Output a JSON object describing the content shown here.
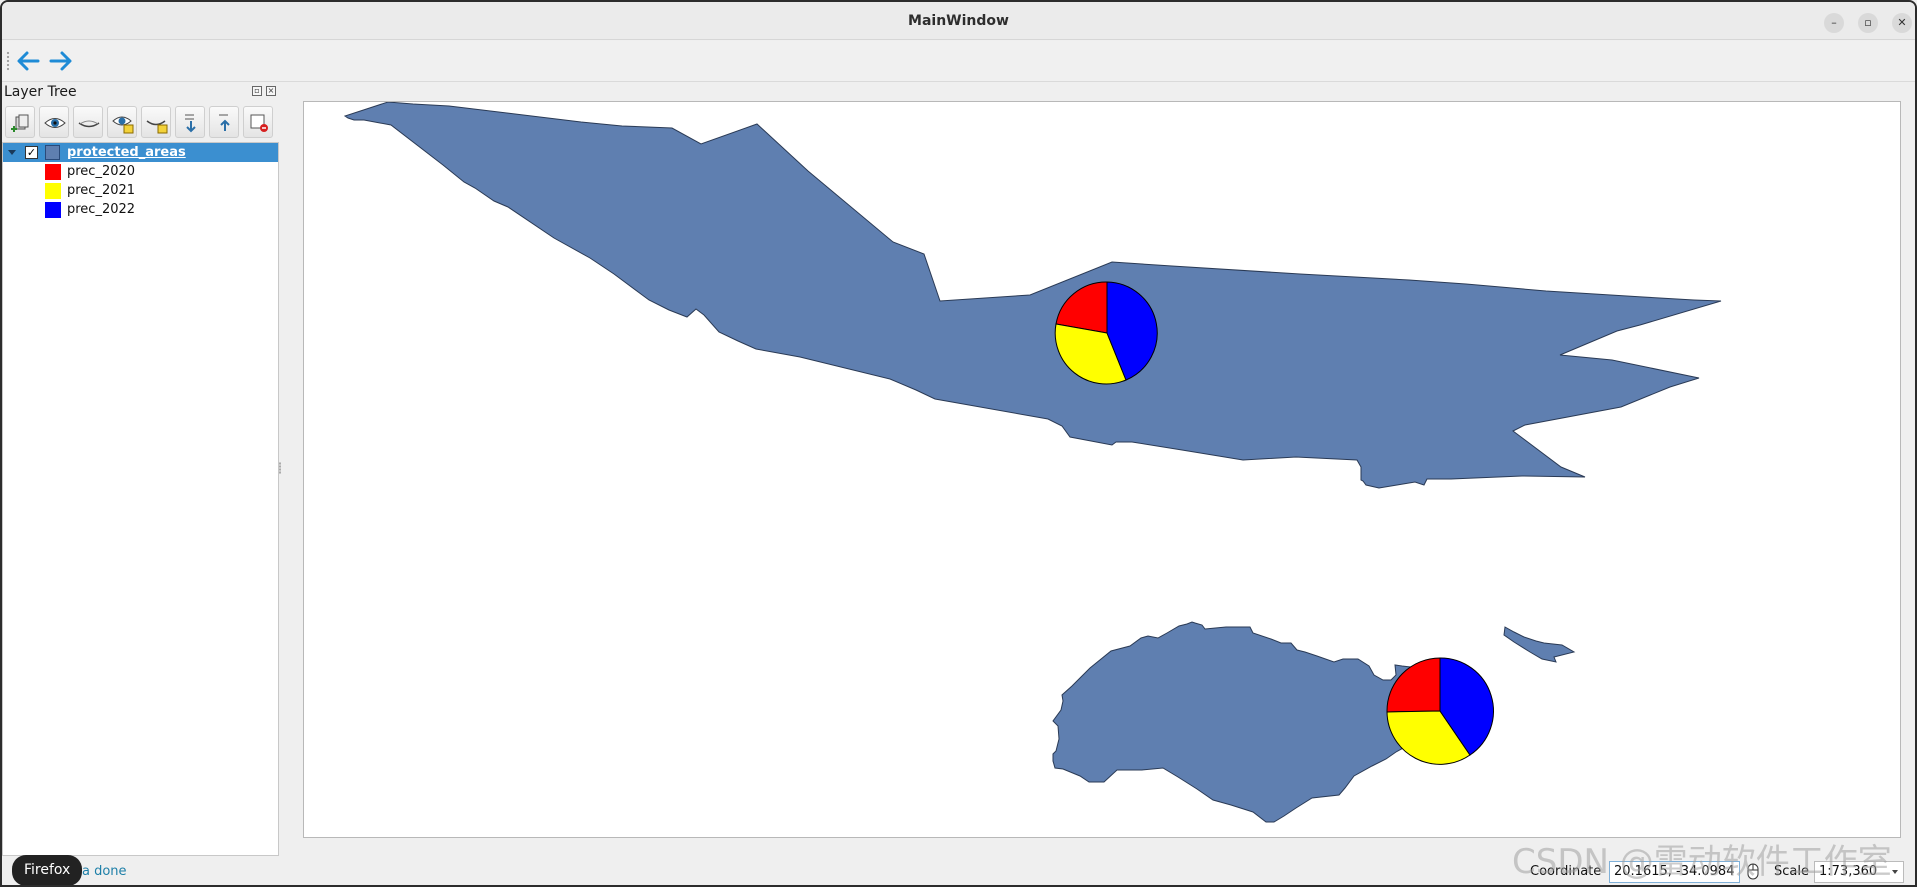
{
  "window": {
    "title": "MainWindow",
    "controls": [
      {
        "name": "minimize",
        "icon": "minimize-icon",
        "glyph": "–"
      },
      {
        "name": "maximize",
        "icon": "maximize-icon",
        "glyph": "▫"
      },
      {
        "name": "close",
        "icon": "close-icon",
        "glyph": "✕"
      }
    ]
  },
  "toolbar": {
    "back": {
      "icon": "arrow-left-icon"
    },
    "forward": {
      "icon": "arrow-right-icon"
    },
    "accent": "#1e8bd6"
  },
  "layer_tree": {
    "title": "Layer Tree",
    "tools": [
      {
        "icon": "add-group-icon"
      },
      {
        "icon": "show-all-layers-icon"
      },
      {
        "icon": "hide-all-layers-icon"
      },
      {
        "icon": "show-selected-layers-icon"
      },
      {
        "icon": "hide-selected-layers-icon"
      },
      {
        "icon": "expand-all-icon"
      },
      {
        "icon": "collapse-all-icon"
      },
      {
        "icon": "remove-layer-icon"
      }
    ],
    "layer": {
      "name": "protected_areas",
      "checked": true,
      "selected": true,
      "check_glyph": "✓",
      "fill_color": "#5f7fb0"
    },
    "legend": [
      {
        "label": "prec_2020",
        "color": "#ff0000"
      },
      {
        "label": "prec_2021",
        "color": "#ffff00"
      },
      {
        "label": "prec_2022",
        "color": "#0000ff"
      }
    ]
  },
  "map": {
    "background": "#ffffff",
    "polygon_fill": "#5f7fb0",
    "polygon_stroke": "#2a3a55",
    "pie_colors": [
      "#ff0000",
      "#ffff00",
      "#0000ff"
    ]
  },
  "status": {
    "message": "a done",
    "tooltip": "Firefox",
    "coordinate_label": "Coordinate",
    "coordinate_value": "20.1615, -34.0984",
    "scale_label": "Scale",
    "scale_value": "1:73,360"
  },
  "watermark": "CSDN @雷动软件工作室"
}
